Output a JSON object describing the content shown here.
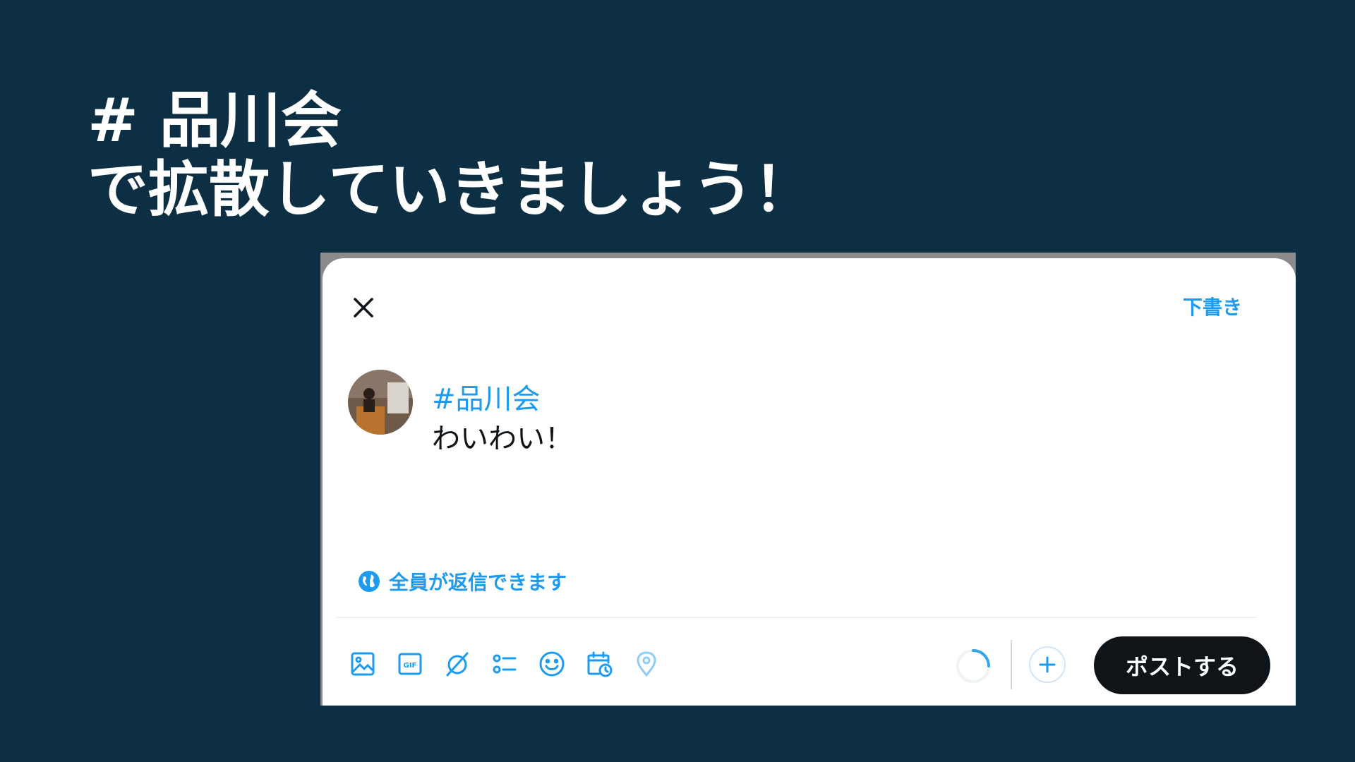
{
  "slide": {
    "title_line1": "# 品川会",
    "title_line2": "で拡散していきましょう！"
  },
  "composer": {
    "drafts_label": "下書き",
    "hashtag": "#品川会",
    "body_text": "わいわい！",
    "reply_setting": "全員が返信できます",
    "post_button": "ポストする"
  },
  "toolbar": {
    "icons": [
      "image-icon",
      "gif-icon",
      "grok-icon",
      "poll-icon",
      "emoji-icon",
      "schedule-icon",
      "location-icon"
    ]
  },
  "colors": {
    "background": "#0d2f44",
    "accent": "#1d9bf0",
    "post_button": "#0f1419"
  }
}
